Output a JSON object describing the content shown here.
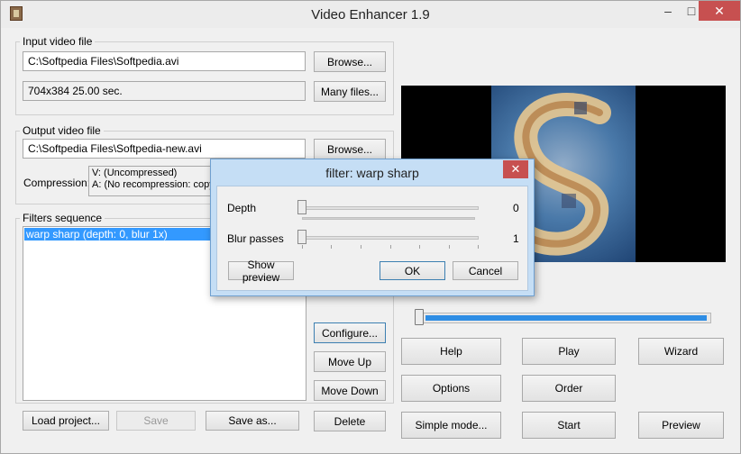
{
  "window": {
    "title": "Video Enhancer 1.9",
    "minimize": "–",
    "maximize": "□",
    "close": "✕"
  },
  "input": {
    "group_label": "Input video file",
    "path": "C:\\Softpedia Files\\Softpedia.avi",
    "info": "704x384 25.00 sec.",
    "browse_label": "Browse...",
    "many_label": "Many files..."
  },
  "output": {
    "group_label": "Output video file",
    "path": "C:\\Softpedia Files\\Softpedia-new.avi",
    "browse_label": "Browse...",
    "compression_label": "Compression:",
    "compression_v": "V: (Uncompressed)",
    "compression_a": "A: (No recompression: copy"
  },
  "filters": {
    "group_label": "Filters sequence",
    "items": [
      "warp sharp (depth: 0, blur 1x)"
    ],
    "configure_label": "Configure...",
    "move_up_label": "Move Up",
    "move_down_label": "Move Down",
    "delete_label": "Delete"
  },
  "project": {
    "load_label": "Load project...",
    "save_label": "Save",
    "save_as_label": "Save as..."
  },
  "actions": {
    "help": "Help",
    "play": "Play",
    "wizard": "Wizard",
    "options": "Options",
    "order": "Order",
    "simple_mode": "Simple mode...",
    "start": "Start",
    "preview": "Preview"
  },
  "position_slider": {
    "value": 0.02
  },
  "dialog": {
    "title": "filter: warp sharp",
    "close": "✕",
    "depth_label": "Depth",
    "depth_value": "0",
    "blur_label": "Blur passes",
    "blur_value": "1",
    "show_preview": "Show preview",
    "ok": "OK",
    "cancel": "Cancel"
  },
  "colors": {
    "selection": "#3399ff",
    "progress": "#2e8de4",
    "close_red": "#c75050",
    "dialog_frame": "#c5def5"
  }
}
